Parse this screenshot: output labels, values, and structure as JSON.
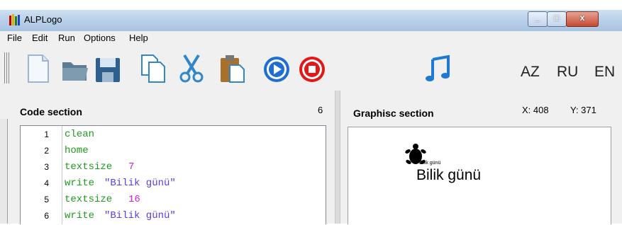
{
  "window": {
    "title": "ALPLogo",
    "close_glyph": "x",
    "minimize_glyph": "_",
    "maximize_glyph": "□"
  },
  "menu": [
    "File",
    "Edit",
    "Run",
    "Options",
    "Help"
  ],
  "toolbar": {
    "icons": [
      "new-file-icon",
      "open-folder-icon",
      "save-icon",
      "copy-icon",
      "cut-icon",
      "paste-icon",
      "run-icon",
      "stop-icon",
      "music-icon"
    ],
    "languages": [
      "AZ",
      "RU",
      "EN"
    ]
  },
  "code_section": {
    "title": "Code section",
    "line_count": "6",
    "lines": [
      {
        "num": "1",
        "keyword": "clean",
        "arg": "",
        "arg_type": ""
      },
      {
        "num": "2",
        "keyword": "home",
        "arg": "",
        "arg_type": ""
      },
      {
        "num": "3",
        "keyword": "textsize",
        "arg": "7",
        "arg_type": "num"
      },
      {
        "num": "4",
        "keyword": "write",
        "arg": "\"Bilik günü\"",
        "arg_type": "str"
      },
      {
        "num": "5",
        "keyword": "textsize",
        "arg": "16",
        "arg_type": "num"
      },
      {
        "num": "6",
        "keyword": "write",
        "arg": "\"Bilik günü\"",
        "arg_type": "str"
      }
    ]
  },
  "graphics_section": {
    "title": "Graphisc section",
    "x_label": "X: 408",
    "y_label": "Y: 371",
    "small_text": "Bilik günü",
    "large_text": "Bilik günü"
  },
  "colors": {
    "keyword": "#1e9a1e",
    "number": "#d21ed2",
    "string": "#5a3ce0",
    "titlebar": "#b9d1ea"
  }
}
